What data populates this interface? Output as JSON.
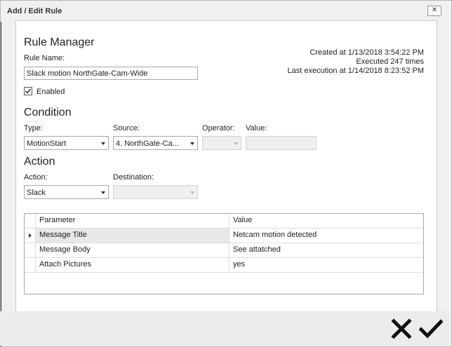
{
  "window": {
    "title": "Add / Edit Rule",
    "close_glyph": "✕"
  },
  "rule_manager": {
    "heading": "Rule Manager",
    "name_label": "Rule Name:",
    "name_value": "Slack motion NorthGate-Cam-Wide",
    "enabled_label": "Enabled",
    "enabled_checked": true,
    "created": "Created at 1/13/2018 3:54:22 PM",
    "executed": "Executed 247 times",
    "last_execution": "Last execution at 1/14/2018 8:23:52 PM"
  },
  "condition": {
    "heading": "Condition",
    "type_label": "Type:",
    "type_value": "MotionStart",
    "source_label": "Source:",
    "source_value": "4. NorthGate-Ca...",
    "operator_label": "Operator:",
    "operator_value": "",
    "value_label": "Value:",
    "value_value": ""
  },
  "action": {
    "heading": "Action",
    "action_label": "Action:",
    "action_value": "Slack",
    "destination_label": "Destination:",
    "destination_value": ""
  },
  "parameters": {
    "columns": [
      "Parameter",
      "Value"
    ],
    "rows": [
      {
        "parameter": "Message Title",
        "value": "Netcam motion detected"
      },
      {
        "parameter": "Message Body",
        "value": "See attatched"
      },
      {
        "parameter": "Attach Pictures",
        "value": "yes"
      }
    ]
  },
  "footer": {
    "cancel_icon": "close-icon",
    "ok_icon": "checkmark-icon"
  }
}
